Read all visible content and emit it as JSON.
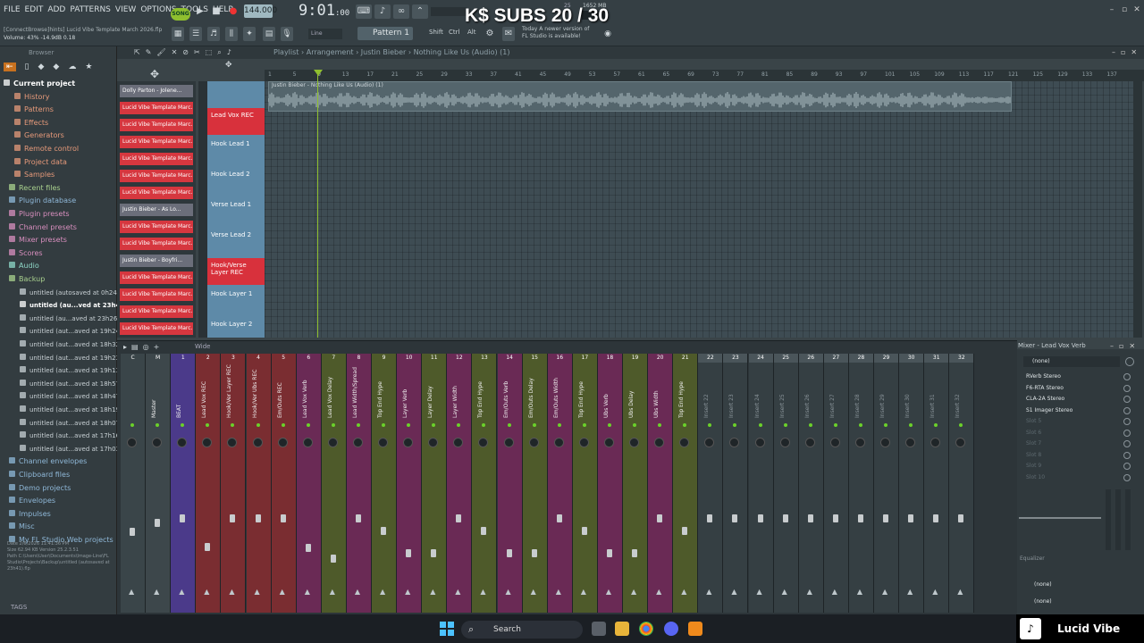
{
  "menu": [
    "FILE",
    "EDIT",
    "ADD",
    "PATTERNS",
    "VIEW",
    "OPTIONS",
    "TOOLS",
    "HELP"
  ],
  "toolbar": {
    "song_label": "SONG",
    "tempo": "144.000",
    "time": "9:01",
    "time_small": ":00",
    "cpu_top": "25",
    "memory": "1652 MB",
    "pattern": "Pattern 1",
    "snap": "Line",
    "shift": "Shift",
    "ctrl": "Ctrl",
    "alt": "Alt",
    "update_msg_1": "Today  A newer version of",
    "update_msg_2": "FL Studio is available!"
  },
  "overlay": {
    "subs": "K$ SUBS 20 / 30"
  },
  "project": {
    "info": "[ConnectBrowse]hints] Lucid Vibe Template March 2026.flp",
    "volume": "Volume: 43%  -14.9dB  0.18"
  },
  "browser": {
    "title": "Browser",
    "items": [
      {
        "label": "Current project",
        "color": "#ffffff",
        "icon": "folder-open-icon",
        "indent": 0,
        "bold": true
      },
      {
        "label": "History",
        "color": "#e79a7a",
        "icon": "history-icon",
        "indent": 2
      },
      {
        "label": "Patterns",
        "color": "#e79a7a",
        "icon": "pattern-icon",
        "indent": 2
      },
      {
        "label": "Effects",
        "color": "#e79a7a",
        "icon": "effects-icon",
        "indent": 2
      },
      {
        "label": "Generators",
        "color": "#e79a7a",
        "icon": "generator-icon",
        "indent": 2
      },
      {
        "label": "Remote control",
        "color": "#e79a7a",
        "icon": "remote-icon",
        "indent": 2
      },
      {
        "label": "Project data",
        "color": "#e79a7a",
        "icon": "data-icon",
        "indent": 2
      },
      {
        "label": "Samples",
        "color": "#e79a7a",
        "icon": "samples-icon",
        "indent": 2
      },
      {
        "label": "Recent files",
        "color": "#a9d18e",
        "icon": "folder-icon",
        "indent": 1
      },
      {
        "label": "Plugin database",
        "color": "#8fb8d8",
        "icon": "plugin-icon",
        "indent": 1
      },
      {
        "label": "Plugin presets",
        "color": "#d98fbf",
        "icon": "preset-icon",
        "indent": 1
      },
      {
        "label": "Channel presets",
        "color": "#d98fbf",
        "icon": "preset-icon",
        "indent": 1
      },
      {
        "label": "Mixer presets",
        "color": "#d98fbf",
        "icon": "preset-icon",
        "indent": 1
      },
      {
        "label": "Scores",
        "color": "#d98fbf",
        "icon": "score-icon",
        "indent": 1
      },
      {
        "label": "Audio",
        "color": "#8fd8c8",
        "icon": "audio-icon",
        "indent": 1
      },
      {
        "label": "Backup",
        "color": "#a9d18e",
        "icon": "folder-open-icon",
        "indent": 1
      },
      {
        "label": "untitled (autosaved at 0h24)",
        "color": "#c8d0d4",
        "icon": "file-icon",
        "indent": 3
      },
      {
        "label": "untitled (au...ved at 23h41)",
        "color": "#ffffff",
        "icon": "file-icon",
        "indent": 3,
        "bold": true
      },
      {
        "label": "untitled (au...aved at 23h26)",
        "color": "#c8d0d4",
        "icon": "file-icon",
        "indent": 3
      },
      {
        "label": "untitled (aut...aved at 19h24)",
        "color": "#c8d0d4",
        "icon": "file-icon",
        "indent": 3
      },
      {
        "label": "untitled (aut...aved at 18h32)",
        "color": "#c8d0d4",
        "icon": "file-icon",
        "indent": 3
      },
      {
        "label": "untitled (aut...aved at 19h23)",
        "color": "#c8d0d4",
        "icon": "file-icon",
        "indent": 3
      },
      {
        "label": "untitled (aut...aved at 19h13)",
        "color": "#c8d0d4",
        "icon": "file-icon",
        "indent": 3
      },
      {
        "label": "untitled (aut...aved at 18h57)",
        "color": "#c8d0d4",
        "icon": "file-icon",
        "indent": 3
      },
      {
        "label": "untitled (aut...aved at 18h47)",
        "color": "#c8d0d4",
        "icon": "file-icon",
        "indent": 3
      },
      {
        "label": "untitled (aut...aved at 18h19)",
        "color": "#c8d0d4",
        "icon": "file-icon",
        "indent": 3
      },
      {
        "label": "untitled (aut...aved at 18h07)",
        "color": "#c8d0d4",
        "icon": "file-icon",
        "indent": 3
      },
      {
        "label": "untitled (aut...aved at 17h16)",
        "color": "#c8d0d4",
        "icon": "file-icon",
        "indent": 3
      },
      {
        "label": "untitled (aut...aved at 17h03)",
        "color": "#c8d0d4",
        "icon": "file-icon",
        "indent": 3
      },
      {
        "label": "Channel envelopes",
        "color": "#8fb8d8",
        "icon": "folder-icon",
        "indent": 1
      },
      {
        "label": "Clipboard files",
        "color": "#8fb8d8",
        "icon": "folder-icon",
        "indent": 1
      },
      {
        "label": "Demo projects",
        "color": "#8fb8d8",
        "icon": "folder-icon",
        "indent": 1
      },
      {
        "label": "Envelopes",
        "color": "#8fb8d8",
        "icon": "folder-icon",
        "indent": 1
      },
      {
        "label": "Impulses",
        "color": "#8fb8d8",
        "icon": "folder-icon",
        "indent": 1
      },
      {
        "label": "Misc",
        "color": "#8fb8d8",
        "icon": "folder-icon",
        "indent": 1
      },
      {
        "label": "My FL Studio Web projects",
        "color": "#8fb8d8",
        "icon": "folder-icon",
        "indent": 1
      }
    ],
    "info_date": "Date  2/6/2026 11:41:36 PM",
    "info_size": "Size  62.94 KB    Version 25.2.3.51",
    "info_path": "Path  C:\\Users\\User\\Documents\\Image-Line\\FL Studio\\Projects\\Backup\\untitled (autosaved at 23h41).flp",
    "tags": "TAGS"
  },
  "playlist": {
    "breadcrumb": "Playlist › Arrangement › Justin Bieber › Nothing Like Us (Audio) (1)",
    "audio_clip": "Justin Bieber - Nothing Like Us (Audio) (1)",
    "ruler": [
      "1",
      "5",
      "9",
      "13",
      "17",
      "21",
      "25",
      "29",
      "33",
      "37",
      "41",
      "45",
      "49",
      "53",
      "57",
      "61",
      "65",
      "69",
      "73",
      "77",
      "81",
      "85",
      "89",
      "93",
      "97",
      "101",
      "105",
      "109",
      "113",
      "117",
      "121",
      "125",
      "129",
      "133",
      "137"
    ],
    "clips": [
      {
        "label": "Dolly Parton - Jolene...",
        "type": "gray"
      },
      {
        "label": "Lucid Vibe Template Marc...",
        "type": "red"
      },
      {
        "label": "Lucid Vibe Template Marc...",
        "type": "red"
      },
      {
        "label": "Lucid Vibe Template Marc...",
        "type": "red"
      },
      {
        "label": "Lucid Vibe Template Marc...",
        "type": "red"
      },
      {
        "label": "Lucid Vibe Template Marc...",
        "type": "red"
      },
      {
        "label": "Lucid Vibe Template Marc...",
        "type": "red"
      },
      {
        "label": "Justin Bieber - As Lo...",
        "type": "gray"
      },
      {
        "label": "Lucid Vibe Template Marc...",
        "type": "red"
      },
      {
        "label": "Lucid Vibe Template Marc...",
        "type": "red"
      },
      {
        "label": "Justin Bieber - Boyfri...",
        "type": "gray"
      },
      {
        "label": "Lucid Vibe Template Marc...",
        "type": "red"
      },
      {
        "label": "Lucid Vibe Template Marc...",
        "type": "red"
      },
      {
        "label": "Lucid Vibe Template Marc...",
        "type": "red"
      },
      {
        "label": "Lucid Vibe Template Marc...",
        "type": "red"
      }
    ],
    "tracks": [
      {
        "label": "Lead Vox REC",
        "type": "red",
        "h": 30
      },
      {
        "label": "Hook Lead 1",
        "type": "blue",
        "h": 32
      },
      {
        "label": "Hook Lead 2",
        "type": "blue",
        "h": 32
      },
      {
        "label": "Verse Lead 1",
        "type": "blue",
        "h": 32
      },
      {
        "label": "Verse Lead 2",
        "type": "blue",
        "h": 32
      },
      {
        "label": "Hook/Verse Layer REC",
        "type": "red",
        "h": 30
      },
      {
        "label": "Hook Layer 1",
        "type": "blue",
        "h": 32
      },
      {
        "label": "Hook Layer 2",
        "type": "blue",
        "h": 32
      }
    ]
  },
  "mixer": {
    "title": "Mixer - Lead Vox Verb",
    "toolbar": "Wide",
    "strips": [
      {
        "num": "C",
        "name": "",
        "color": "#3a4549",
        "fader": 0.35
      },
      {
        "num": "M",
        "name": "Master",
        "color": "#3d474b",
        "fader": 0.45
      },
      {
        "num": "1",
        "name": "BEAT",
        "color": "#4b3a8a",
        "fader": 0.5
      },
      {
        "num": "2",
        "name": "Lead Vox REC",
        "color": "#7a2d31",
        "fader": 0.18
      },
      {
        "num": "3",
        "name": "Hook/Ver Layer REC",
        "color": "#7a2d31",
        "fader": 0.5
      },
      {
        "num": "4",
        "name": "Hook/Ver Ubs REC",
        "color": "#7a2d31",
        "fader": 0.5
      },
      {
        "num": "5",
        "name": "Em/Outs REC",
        "color": "#7a2d31",
        "fader": 0.5
      },
      {
        "num": "6",
        "name": "Lead Vox Verb",
        "color": "#6a2a55",
        "fader": 0.17
      },
      {
        "num": "7",
        "name": "Lead Vox Delay",
        "color": "#4e5a2a",
        "fader": 0.05
      },
      {
        "num": "8",
        "name": "Lead Width/Spread",
        "color": "#6a2a55",
        "fader": 0.5
      },
      {
        "num": "9",
        "name": "Top End Hype",
        "color": "#4e5a2a",
        "fader": 0.36
      },
      {
        "num": "10",
        "name": "Layer Verb",
        "color": "#6a2a55",
        "fader": 0.11
      },
      {
        "num": "11",
        "name": "Layer Delay",
        "color": "#4e5a2a",
        "fader": 0.11
      },
      {
        "num": "12",
        "name": "Layer Width",
        "color": "#6a2a55",
        "fader": 0.5
      },
      {
        "num": "13",
        "name": "Top End Hype",
        "color": "#4e5a2a",
        "fader": 0.36
      },
      {
        "num": "14",
        "name": "Em/Outs Verb",
        "color": "#6a2a55",
        "fader": 0.11
      },
      {
        "num": "15",
        "name": "Em/Outs Delay",
        "color": "#4e5a2a",
        "fader": 0.11
      },
      {
        "num": "16",
        "name": "Em/Outs Width",
        "color": "#6a2a55",
        "fader": 0.5
      },
      {
        "num": "17",
        "name": "Top End Hype",
        "color": "#4e5a2a",
        "fader": 0.36
      },
      {
        "num": "18",
        "name": "Ubs Verb",
        "color": "#6a2a55",
        "fader": 0.11
      },
      {
        "num": "19",
        "name": "Ubs Delay",
        "color": "#4e5a2a",
        "fader": 0.11
      },
      {
        "num": "20",
        "name": "Ubs Width",
        "color": "#6a2a55",
        "fader": 0.5
      },
      {
        "num": "21",
        "name": "Top End Hype",
        "color": "#4e5a2a",
        "fader": 0.36
      },
      {
        "num": "22",
        "name": "Insert 22",
        "color": "#353f43",
        "fader": 0.5
      },
      {
        "num": "23",
        "name": "Insert 23",
        "color": "#353f43",
        "fader": 0.5
      },
      {
        "num": "24",
        "name": "Insert 24",
        "color": "#353f43",
        "fader": 0.5
      },
      {
        "num": "25",
        "name": "Insert 25",
        "color": "#353f43",
        "fader": 0.5
      },
      {
        "num": "26",
        "name": "Insert 26",
        "color": "#353f43",
        "fader": 0.5
      },
      {
        "num": "27",
        "name": "Insert 27",
        "color": "#353f43",
        "fader": 0.5
      },
      {
        "num": "28",
        "name": "Insert 28",
        "color": "#353f43",
        "fader": 0.5
      },
      {
        "num": "29",
        "name": "Insert 29",
        "color": "#353f43",
        "fader": 0.5
      },
      {
        "num": "30",
        "name": "Insert 30",
        "color": "#353f43",
        "fader": 0.5
      },
      {
        "num": "31",
        "name": "Insert 31",
        "color": "#353f43",
        "fader": 0.5
      },
      {
        "num": "32",
        "name": "Insert 32",
        "color": "#353f43",
        "fader": 0.5
      }
    ],
    "input": "(none)",
    "slots": [
      "RVerb Stereo",
      "F6-RTA Stereo",
      "CLA-2A Stereo",
      "S1 Imager Stereo",
      "Slot 5",
      "Slot 6",
      "Slot 7",
      "Slot 8",
      "Slot 9",
      "Slot 10"
    ],
    "equalizer": "Equalizer",
    "output_1": "(none)",
    "output_2": "(none)"
  },
  "taskbar": {
    "search": "Search",
    "user": "Lucid Vibe"
  },
  "colors": {
    "accent_green": "#8fbf2f",
    "record_red": "#d6373f"
  }
}
